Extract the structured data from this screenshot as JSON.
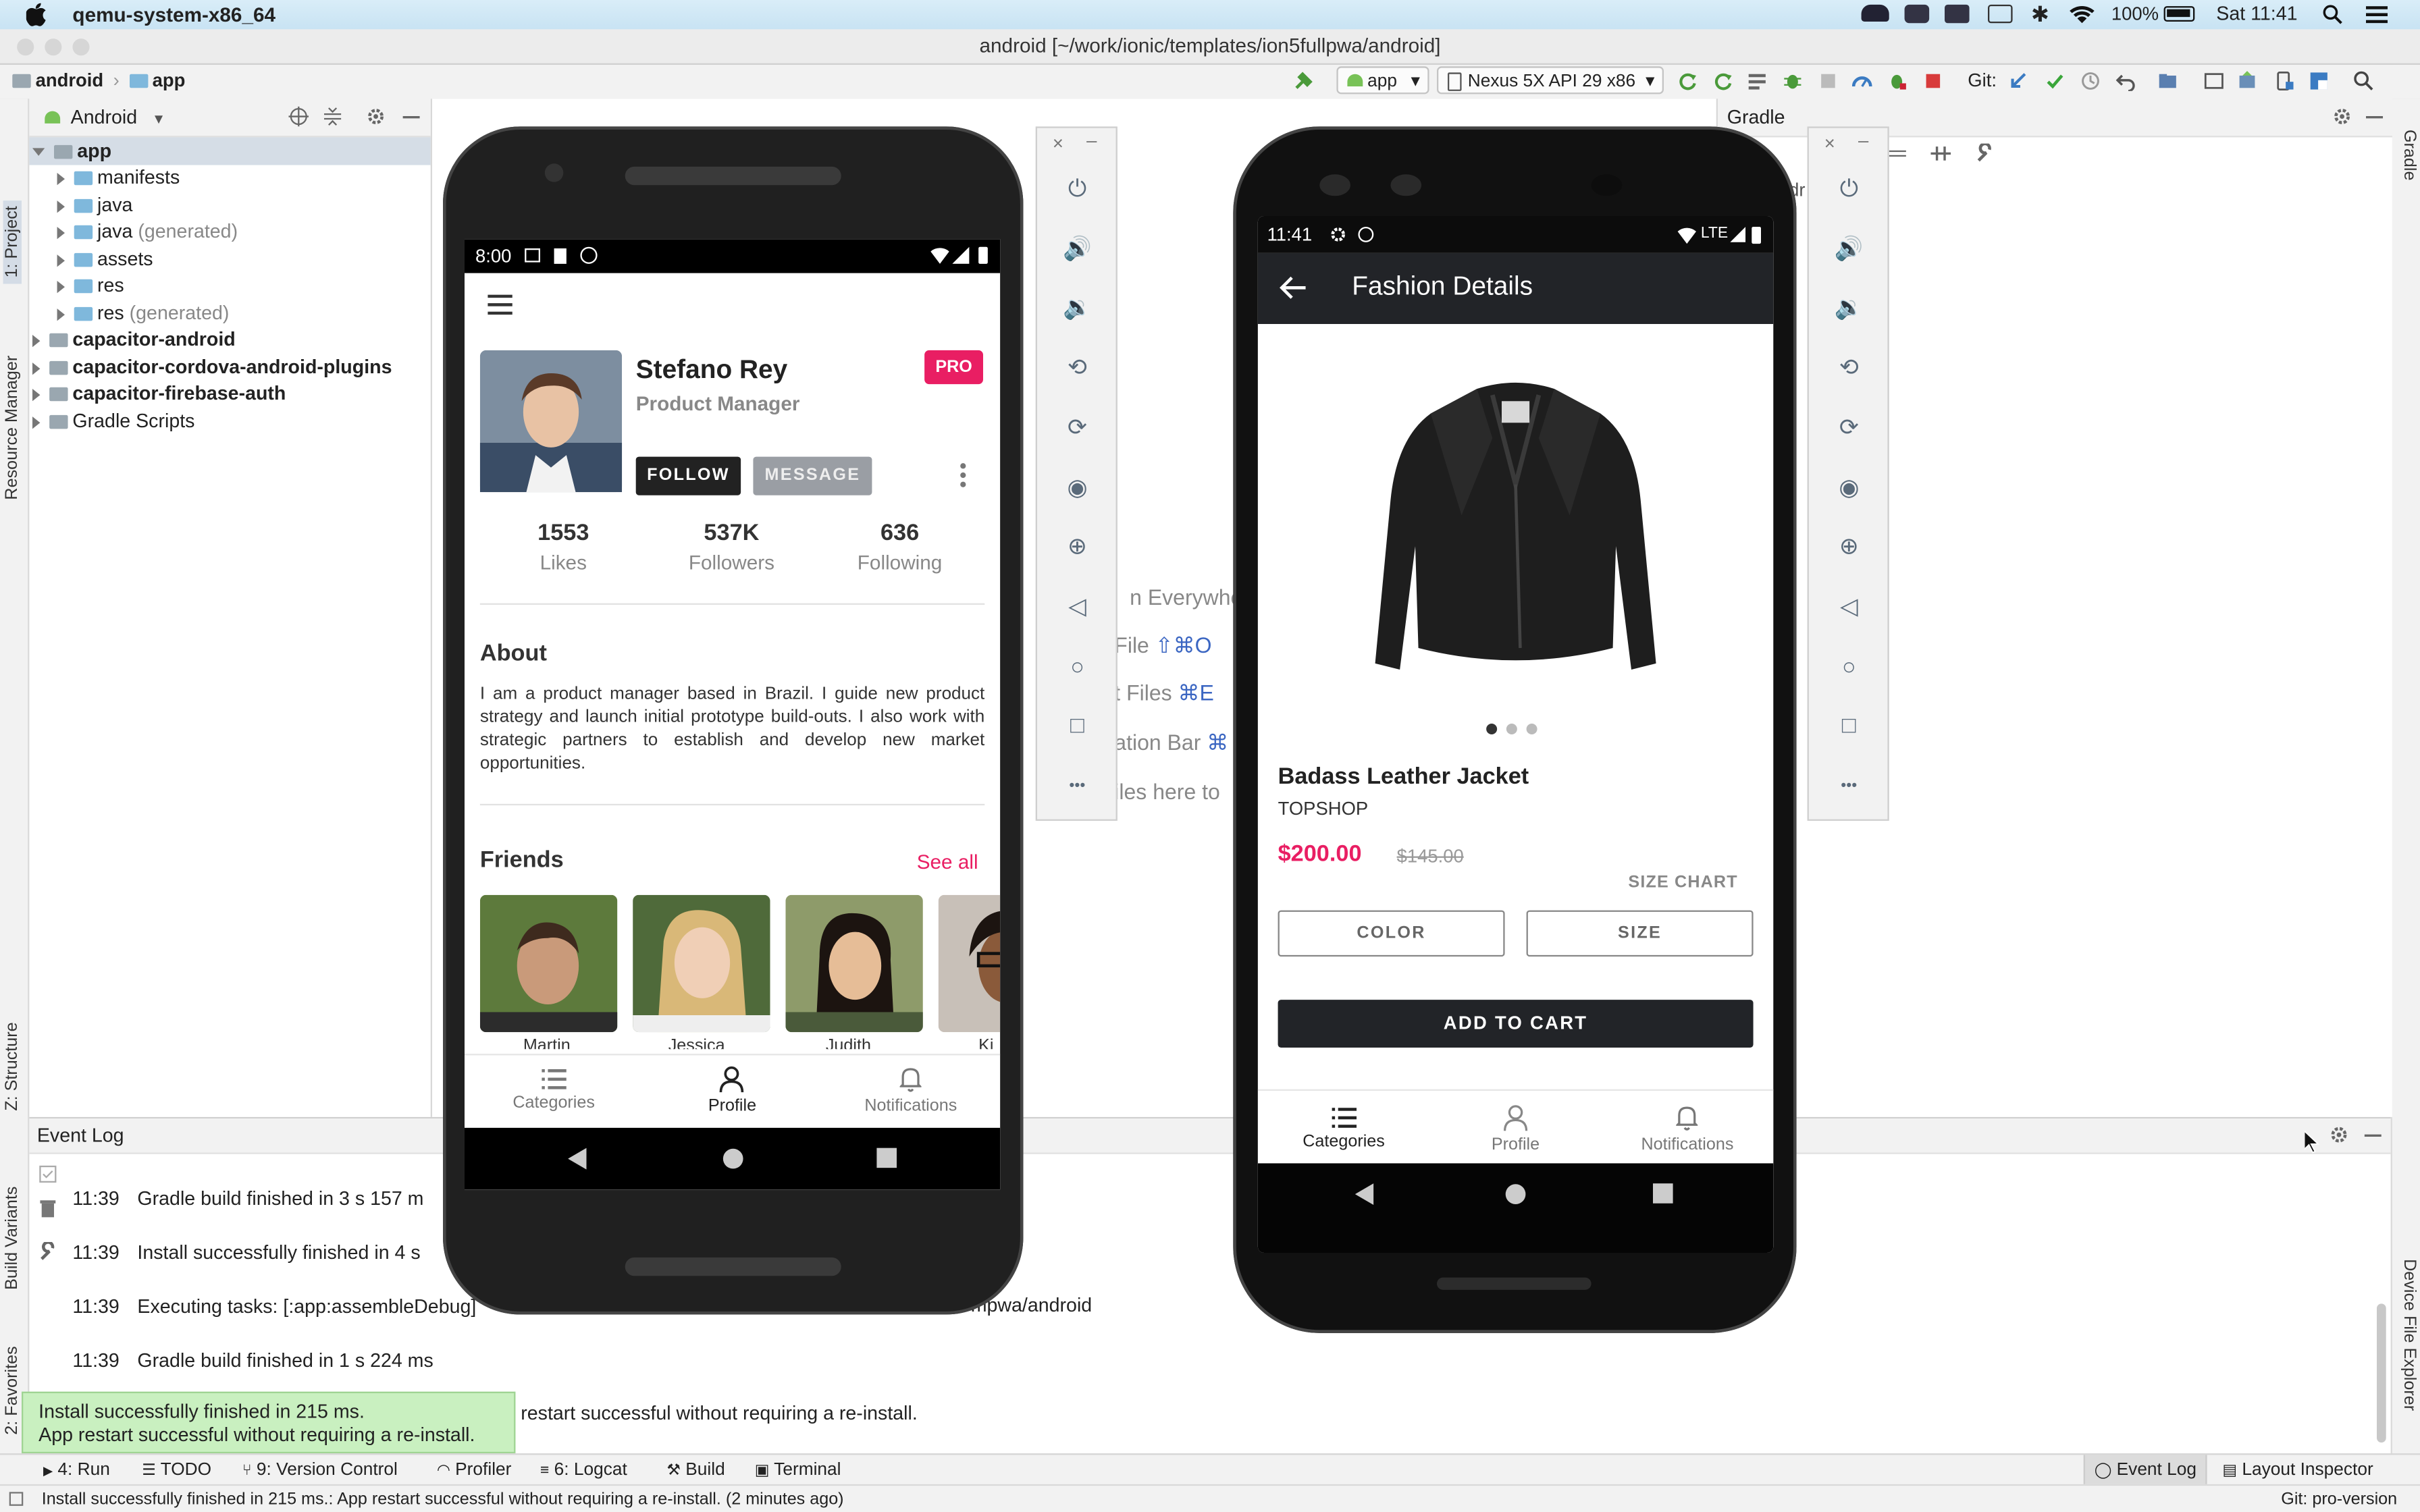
{
  "menubar": {
    "app_name": "qemu-system-x86_64",
    "battery": "100%",
    "clock": "Sat 11:41"
  },
  "window": {
    "title": "android [~/work/ionic/templates/ion5fullpwa/android]"
  },
  "navbar": {
    "crumb_root": "android",
    "crumb_module": "app",
    "run_config": "app",
    "device": "Nexus 5X API 29 x86",
    "git_label": "Git:"
  },
  "left_strip": {
    "project_tab": "1: Project",
    "resource_tab": "Resource Manager",
    "structure_tab": "Z: Structure",
    "build_variants_tab": "Build Variants",
    "favorites_tab": "2: Favorites"
  },
  "right_strip": {
    "gradle_tab": "Gradle",
    "device_explorer_tab": "Device File Explorer"
  },
  "project": {
    "view_mode": "Android",
    "tree": [
      {
        "label": "app",
        "depth": 0,
        "bold": true,
        "suffix": ""
      },
      {
        "label": "manifests",
        "depth": 1,
        "bold": false,
        "suffix": ""
      },
      {
        "label": "java",
        "depth": 1,
        "bold": false,
        "suffix": ""
      },
      {
        "label": "java",
        "depth": 1,
        "bold": false,
        "suffix": " (generated)"
      },
      {
        "label": "assets",
        "depth": 1,
        "bold": false,
        "suffix": ""
      },
      {
        "label": "res",
        "depth": 1,
        "bold": false,
        "suffix": ""
      },
      {
        "label": "res",
        "depth": 1,
        "bold": false,
        "suffix": " (generated)"
      },
      {
        "label": "capacitor-android",
        "depth": 0,
        "bold": true,
        "suffix": ""
      },
      {
        "label": "capacitor-cordova-android-plugins",
        "depth": 0,
        "bold": true,
        "suffix": ""
      },
      {
        "label": "capacitor-firebase-auth",
        "depth": 0,
        "bold": true,
        "suffix": ""
      },
      {
        "label": "Gradle Scripts",
        "depth": 0,
        "bold": false,
        "suffix": ""
      }
    ]
  },
  "editor_hints": {
    "search_everywhere": "n Everywhe",
    "goto_file": "File",
    "goto_file_key": "⇧⌘O",
    "recent_files": "t Files",
    "recent_files_key": "⌘E",
    "nav_bar": "ation Bar",
    "nav_bar_key": "⌘",
    "drop_files": "iles here to"
  },
  "gradle_panel": {
    "title": "Gradle",
    "partial": "dr"
  },
  "event_log": {
    "title": "Event Log",
    "lines": [
      {
        "time": "11:39",
        "text": "Gradle build finished in 3 s 157 m"
      },
      {
        "time": "11:39",
        "text": "Install successfully finished in 4 s"
      },
      {
        "time": "11:39",
        "text": "Executing tasks: [:app:assembleDebug]"
      },
      {
        "time": "11:39",
        "text": "Gradle build finished in 1 s 224 ms"
      }
    ],
    "line4_tail": "mpwa/android",
    "line5_tail": "p restart successful without requiring a re-install."
  },
  "toast": {
    "line1": "Install successfully finished in 215 ms.",
    "line2": "App restart successful without requiring a re-install."
  },
  "tool_tabs": {
    "run": "4: Run",
    "todo": "TODO",
    "version_control": "9: Version Control",
    "profiler": "Profiler",
    "logcat": "6: Logcat",
    "build": "Build",
    "terminal": "Terminal",
    "event_log": "Event Log",
    "layout_inspector": "Layout Inspector"
  },
  "status": {
    "message": "Install successfully finished in 215 ms.: App restart successful without requiring a re-install. (2 minutes ago)",
    "git": "Git: pro-version"
  },
  "phone1": {
    "time": "8:00",
    "name": "Stefano Rey",
    "role": "Product Manager",
    "badge": "PRO",
    "follow": "FOLLOW",
    "message": "MESSAGE",
    "stats": [
      {
        "value": "1553",
        "label": "Likes"
      },
      {
        "value": "537K",
        "label": "Followers"
      },
      {
        "value": "636",
        "label": "Following"
      }
    ],
    "about_title": "About",
    "about_text": "I am a product manager based in Brazil. I guide new product strategy and launch initial prototype build-outs. I also work with strategic partners to establish and develop new market opportunities.",
    "friends_title": "Friends",
    "see_all": "See all",
    "friend_names": [
      "Martin",
      "Jessica",
      "Judith",
      "Ki"
    ],
    "tabs": [
      "Categories",
      "Profile",
      "Notifications"
    ]
  },
  "phone2": {
    "time": "11:41",
    "network": "LTE",
    "header_title": "Fashion Details",
    "product_name": "Badass Leather Jacket",
    "brand": "TOPSHOP",
    "price": "$200.00",
    "old_price": "$145.00",
    "size_chart": "SIZE CHART",
    "color_btn": "COLOR",
    "size_btn": "SIZE",
    "add_to_cart": "ADD TO CART",
    "tabs": [
      "Categories",
      "Profile",
      "Notifications"
    ]
  },
  "colors": {
    "accent_pink": "#e91e63",
    "dark_header": "#222428",
    "ide_blue": "#3b66c2"
  }
}
